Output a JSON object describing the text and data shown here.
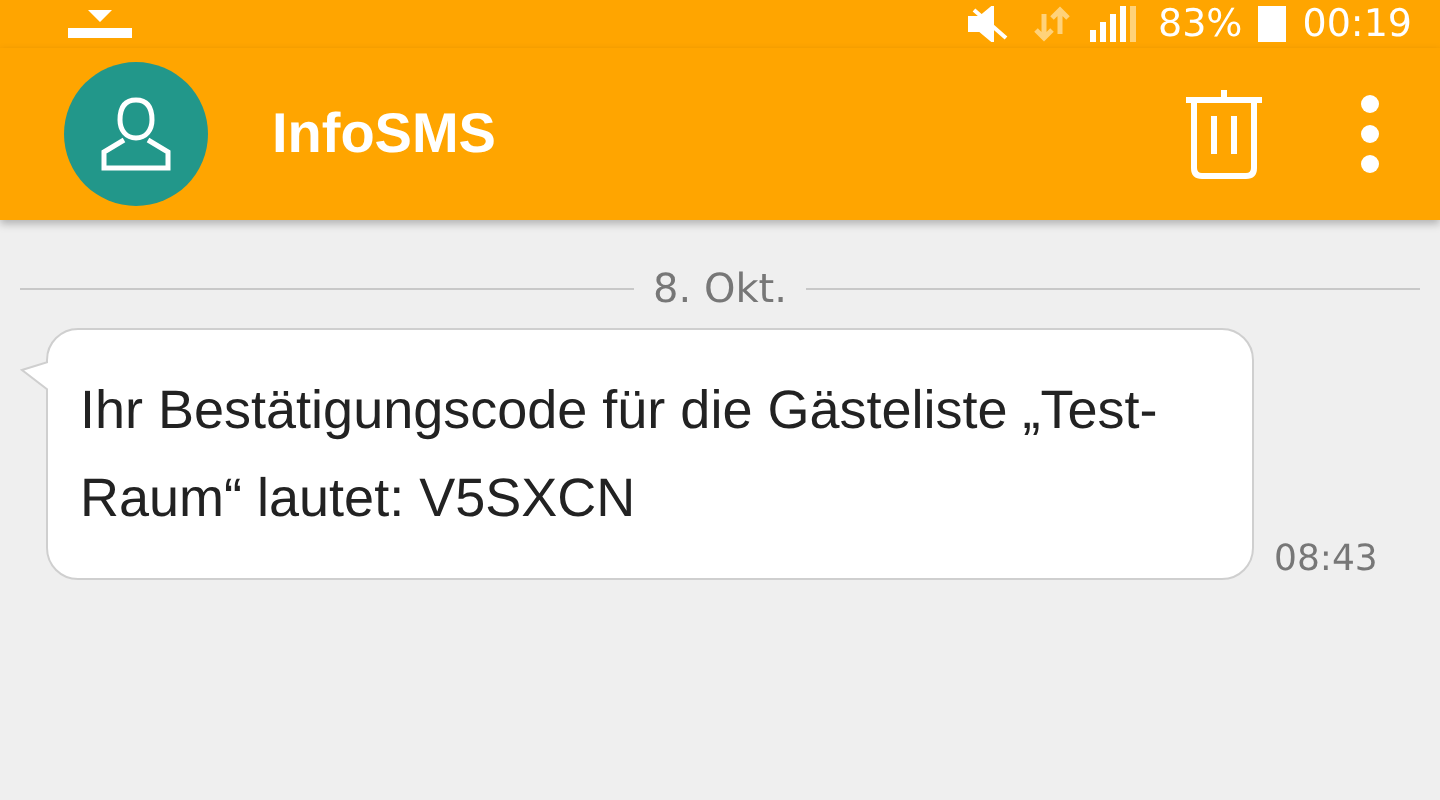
{
  "status_bar": {
    "battery": "83%",
    "time": "00:19"
  },
  "app_bar": {
    "title": "InfoSMS"
  },
  "date_divider": "8. Okt.",
  "messages": [
    {
      "text": "Ihr Bestätigungscode für die Gästeliste „Test-Raum“ lautet: V5SXCN",
      "time": "08:43"
    }
  ]
}
